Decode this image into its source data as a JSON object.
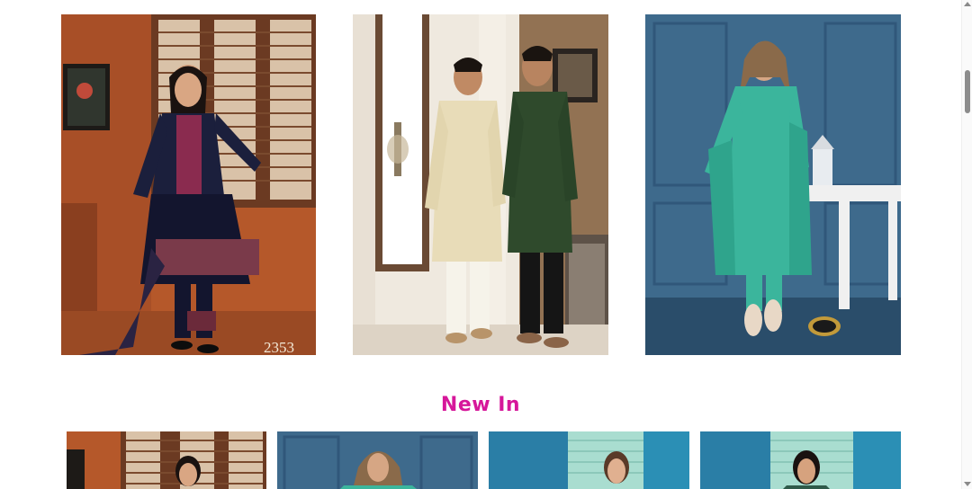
{
  "featured": [
    {
      "sku": "2353",
      "alt": "girl-anarkali-suit"
    },
    {
      "sku": "",
      "alt": "men-kurta-pair"
    },
    {
      "sku": "",
      "alt": "women-teal-kurta-set"
    }
  ],
  "new_in": {
    "title": "New In",
    "items": [
      {
        "alt": "girl-suit"
      },
      {
        "alt": "woman-teal-suit"
      },
      {
        "alt": "woman-mint-suit"
      },
      {
        "alt": "woman-green-suit"
      }
    ]
  },
  "colors": {
    "accent": "#d6179a"
  }
}
